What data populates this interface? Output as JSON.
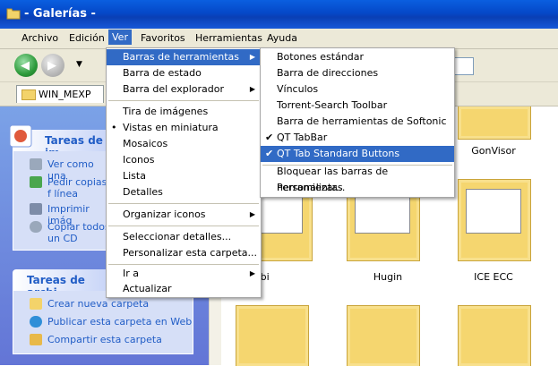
{
  "window": {
    "title": "- Galerías -"
  },
  "menubar": {
    "items": [
      "Archivo",
      "Edición",
      "Ver",
      "Favoritos",
      "Herramientas",
      "Ayuda"
    ]
  },
  "tab": {
    "label": "WIN_MEXP"
  },
  "left_panel": {
    "system_tasks_title": "Tareas de im",
    "system_tasks": [
      "Ver como una",
      "Pedir copias f línea",
      "Imprimir imág",
      "Copiar todos un CD"
    ],
    "file_tasks_title": "Tareas de archi",
    "file_tasks": [
      "Crear nueva carpeta",
      "Publicar esta carpeta en Web",
      "Compartir esta carpeta"
    ]
  },
  "view_menu": {
    "items": [
      "Barras de herramientas",
      "Barra de estado",
      "Barra del explorador",
      "Tira de imágenes",
      "Vistas en miniatura",
      "Mosaicos",
      "Iconos",
      "Lista",
      "Detalles",
      "Organizar iconos",
      "Seleccionar detalles...",
      "Personalizar esta carpeta...",
      "Ir a",
      "Actualizar"
    ]
  },
  "toolbars_submenu": {
    "items": [
      "Botones estándar",
      "Barra de direcciones",
      "Vínculos",
      "Torrent-Search Toolbar",
      "Barra de herramientas de Softonic",
      "QT TabBar",
      "QT Tab Standard Buttons",
      "Bloquear las barras de herramientas",
      "Personalizar..."
    ],
    "checks": [
      "✔",
      "✔"
    ]
  },
  "folders": {
    "labels": [
      "GonVisor",
      "Gisbi",
      "Hugin",
      "ICE ECC"
    ]
  },
  "icons": {
    "back": "back-arrow-icon",
    "forward": "forward-arrow-icon",
    "bullet": "•",
    "submenu": "▶"
  }
}
